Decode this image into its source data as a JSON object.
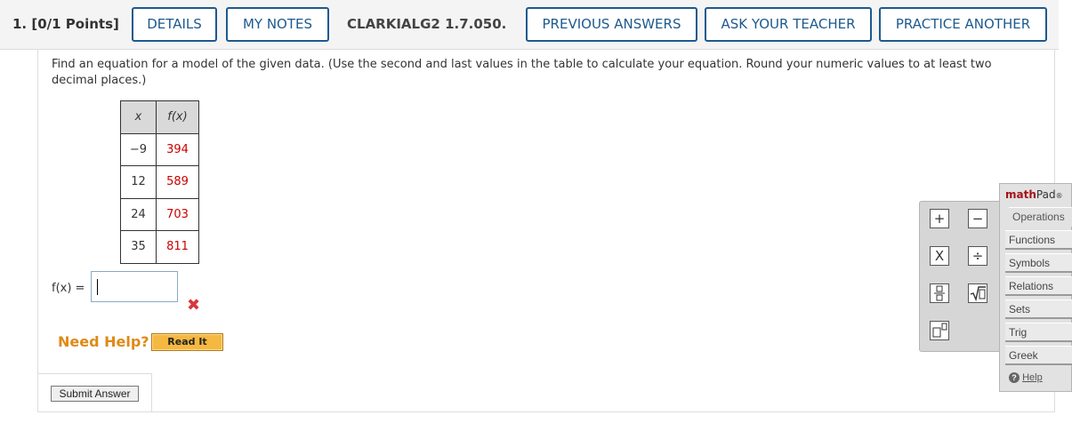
{
  "header": {
    "points": "1.  [0/1 Points]",
    "details_label": "DETAILS",
    "my_notes_label": "MY NOTES",
    "problem_code": "CLARKIALG2 1.7.050.",
    "previous_answers_label": "PREVIOUS ANSWERS",
    "ask_teacher_label": "ASK YOUR TEACHER",
    "practice_another_label": "PRACTICE ANOTHER"
  },
  "question": {
    "text": "Find an equation for a model of the given data. (Use the second and last values in the table to calculate your equation. Round your numeric values to at least two decimal places.)"
  },
  "table": {
    "header_x": "x",
    "header_fx": "f(x)",
    "rows": [
      {
        "x": "−9",
        "fx": "394"
      },
      {
        "x": "12",
        "fx": "589"
      },
      {
        "x": "24",
        "fx": "703"
      },
      {
        "x": "35",
        "fx": "811"
      }
    ]
  },
  "answer": {
    "label": "f(x)  =",
    "value": "",
    "status_mark": "✖"
  },
  "help": {
    "need_help_label": "Need Help?",
    "read_it_label": "Read It"
  },
  "submit_label": "Submit Answer",
  "keypad": {
    "plus": "+",
    "minus": "−",
    "times": "X",
    "divide": "÷",
    "fraction": "□/□",
    "sqrt": "√□",
    "power": "□□"
  },
  "mathpad": {
    "title_bold": "math",
    "title_rest": "Pad",
    "tabs": [
      "Operations",
      "Functions",
      "Symbols",
      "Relations",
      "Sets",
      "Trig",
      "Greek"
    ],
    "help_label": "Help"
  }
}
